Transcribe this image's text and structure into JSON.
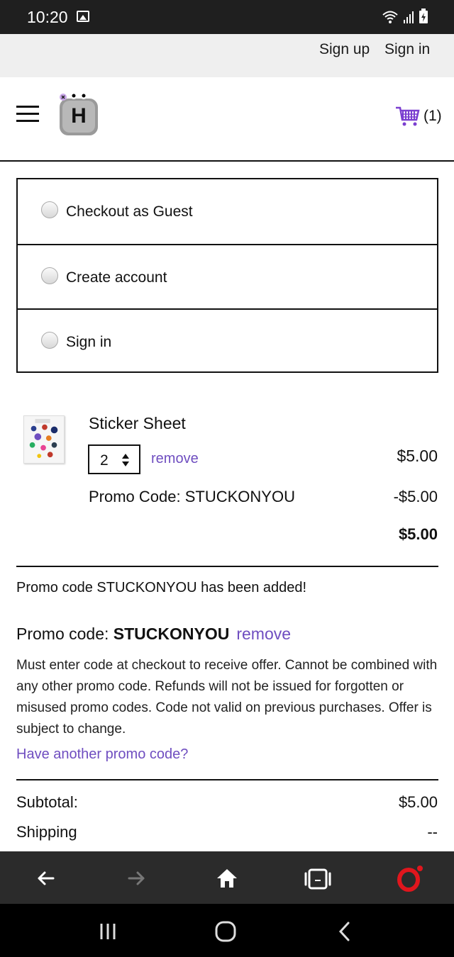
{
  "status_bar": {
    "time": "10:20"
  },
  "account_links": {
    "sign_up": "Sign up",
    "sign_in": "Sign in"
  },
  "header": {
    "cart_count": "(1)",
    "logo": "hinge-mascot-logo"
  },
  "checkout_options": [
    {
      "label": "Checkout as Guest",
      "selected": false
    },
    {
      "label": "Create account",
      "selected": false
    },
    {
      "label": "Sign in",
      "selected": false
    }
  ],
  "cart_item": {
    "name": "Sticker Sheet",
    "quantity": "2",
    "remove_label": "remove",
    "price": "$5.00",
    "promo_line": "Promo Code: STUCKONYOU",
    "promo_discount": "-$5.00",
    "total": "$5.00"
  },
  "promo": {
    "added_message": "Promo code STUCKONYOU has been added!",
    "code_label": "Promo code: ",
    "code": "STUCKONYOU",
    "remove_label": "remove",
    "terms": "Must enter code at checkout to receive offer. Cannot be combined with any other promo code. Refunds will not be issued for forgotten or misused promo codes. Code not valid on previous purchases. Offer is subject to change.",
    "another_link": "Have another promo code?"
  },
  "summary": {
    "subtotal_label": "Subtotal:",
    "subtotal_value": "$5.00",
    "shipping_label": "Shipping",
    "shipping_value": "--"
  },
  "colors": {
    "accent": "#6f4ec0",
    "cart_icon": "#7b3fd0",
    "opera_red": "#e0161d"
  }
}
